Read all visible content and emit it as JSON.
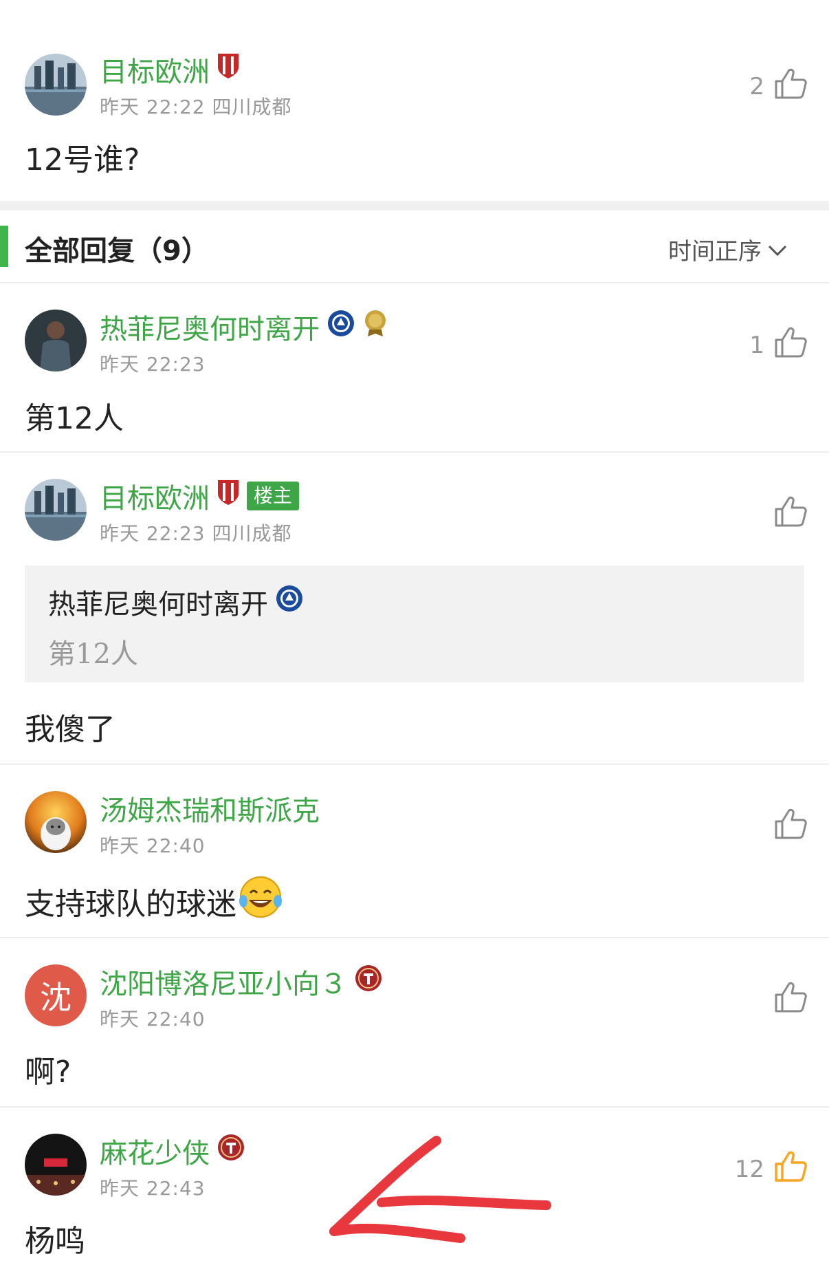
{
  "post": {
    "author": "目标欧洲",
    "time": "昨天 22:22 四川成都",
    "likes": "2",
    "content": "12号谁?"
  },
  "replies_header": {
    "title": "全部回复（9）",
    "sort_label": "时间正序"
  },
  "replies": [
    {
      "author": "热菲尼奥何时离开",
      "time": "昨天 22:23",
      "likes": "1",
      "content": "第12人"
    },
    {
      "author": "目标欧洲",
      "host_badge": "楼主",
      "time": "昨天 22:23 四川成都",
      "likes": "",
      "quote_author": "热菲尼奥何时离开",
      "quote_text": "第12人",
      "content": "我傻了"
    },
    {
      "author": "汤姆杰瑞和斯派克",
      "time": "昨天 22:40",
      "likes": "",
      "content": "支持球队的球迷"
    },
    {
      "author": "沈阳博洛尼亚小向３",
      "avatar_text": "沈",
      "time": "昨天 22:40",
      "likes": "",
      "content": "啊?"
    },
    {
      "author": "麻花少侠",
      "time": "昨天 22:43",
      "likes": "12",
      "content": "杨鸣"
    }
  ],
  "colors": {
    "accent_green": "#3fa648",
    "like_orange": "#f5a623",
    "annotation_red": "#e8383d"
  }
}
